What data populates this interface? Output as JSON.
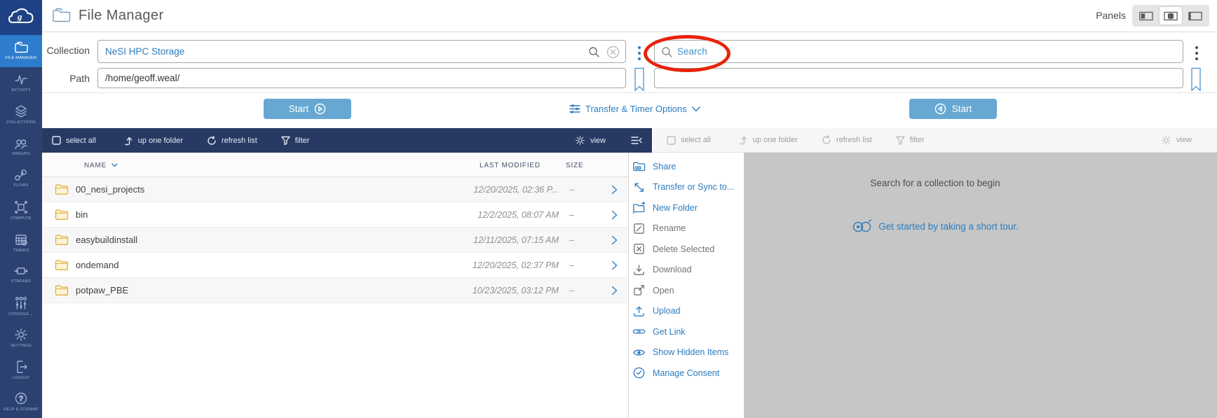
{
  "colors": {
    "accent_blue": "#2d7cbe",
    "active_nav_blue": "#2e7ccc",
    "sidebar_navy": "#2c4170",
    "toolbar_navy": "#283a64",
    "start_button_blue": "#67a8d3",
    "annotation_red": "#e8230b",
    "gray_panel": "#c6c6c6",
    "folder_yellow": "#e0b13e"
  },
  "header": {
    "title": "File Manager",
    "panels_label": "Panels"
  },
  "sidebar": {
    "items": [
      {
        "label": "FILE MANAGER"
      },
      {
        "label": "ACTIVITY"
      },
      {
        "label": "COLLECTIONS"
      },
      {
        "label": "GROUPS"
      },
      {
        "label": "FLOWS"
      },
      {
        "label": "COMPUTE"
      },
      {
        "label": "TIMERS"
      },
      {
        "label": "STREAMS"
      },
      {
        "label": "CONSOLE"
      },
      {
        "label": "SETTINGS"
      },
      {
        "label": "LOGOUT"
      },
      {
        "label": "HELP & SITEMAP"
      }
    ]
  },
  "left_panel": {
    "collection_label": "Collection",
    "collection_value": "NeSI HPC Storage",
    "path_label": "Path",
    "path_value": "/home/geoff.weal/",
    "start_label": "Start",
    "toolbar": {
      "select_all": "select all",
      "up_one_folder": "up one folder",
      "refresh_list": "refresh list",
      "filter": "filter",
      "view": "view"
    },
    "columns": {
      "name": "NAME",
      "last_modified": "LAST MODIFIED",
      "size": "SIZE"
    },
    "rows": [
      {
        "name": "00_nesi_projects",
        "modified": "12/20/2025, 02:36 P...",
        "size": "–"
      },
      {
        "name": "bin",
        "modified": "12/2/2025, 08:07 AM",
        "size": "–"
      },
      {
        "name": "easybuildinstall",
        "modified": "12/11/2025, 07:15 AM",
        "size": "–"
      },
      {
        "name": "ondemand",
        "modified": "12/20/2025, 02:37 PM",
        "size": "–"
      },
      {
        "name": "potpaw_PBE",
        "modified": "10/23/2025, 03:12 PM",
        "size": "–"
      }
    ]
  },
  "transfer_bar": {
    "options_label": "Transfer & Timer Options"
  },
  "right_panel": {
    "search_placeholder": "Search",
    "start_label": "Start",
    "toolbar": {
      "select_all": "select all",
      "up_one_folder": "up one folder",
      "refresh_list": "refresh list",
      "filter": "filter",
      "view": "view"
    },
    "empty_title": "Search for a collection to begin",
    "tour_link": "Get started by taking a short tour."
  },
  "action_menu": {
    "items": [
      {
        "label": "Share",
        "enabled": true
      },
      {
        "label": "Transfer or Sync to...",
        "enabled": true
      },
      {
        "label": "New Folder",
        "enabled": true
      },
      {
        "label": "Rename",
        "enabled": false
      },
      {
        "label": "Delete Selected",
        "enabled": false
      },
      {
        "label": "Download",
        "enabled": false
      },
      {
        "label": "Open",
        "enabled": false
      },
      {
        "label": "Upload",
        "enabled": true
      },
      {
        "label": "Get Link",
        "enabled": true
      },
      {
        "label": "Show Hidden Items",
        "enabled": true
      },
      {
        "label": "Manage Consent",
        "enabled": true
      }
    ]
  }
}
